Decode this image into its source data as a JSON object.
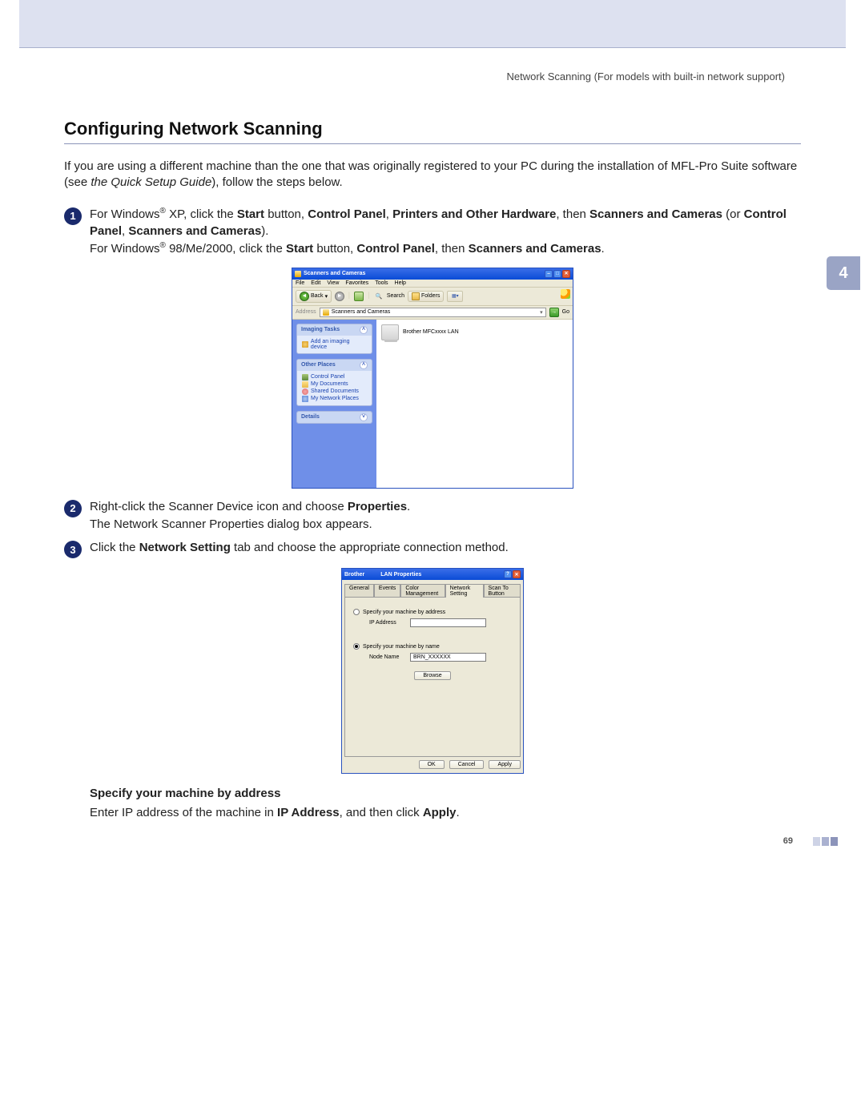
{
  "header": {
    "chapter_text": "Network Scanning (For models with built-in network support)"
  },
  "section_title": "Configuring Network Scanning",
  "intro": {
    "part1": "If you are using a different machine than the one that was originally registered to your PC during the installation of MFL-Pro Suite software (see ",
    "italic": "the Quick Setup Guide",
    "part2": "), follow the steps below."
  },
  "steps": {
    "s1": {
      "num": "1",
      "t1": "For Windows",
      "sup": "®",
      "t2": " XP, click the ",
      "b1": "Start",
      "t3": " button, ",
      "b2": "Control Panel",
      "t4": ", ",
      "b3": "Printers and Other Hardware",
      "t5": ", then ",
      "b4": "Scanners and Cameras",
      "t6": " (or ",
      "b5": "Control Panel",
      "t7": ", ",
      "b6": "Scanners and Cameras",
      "t8": ").",
      "t9": "For Windows",
      "t10": " 98/Me/2000, click the ",
      "b7": "Start",
      "t11": " button, ",
      "b8": "Control Panel",
      "t12": ", then ",
      "b9": "Scanners and Cameras",
      "t13": "."
    },
    "s2": {
      "num": "2",
      "t1": "Right-click the Scanner Device icon and choose ",
      "b1": "Properties",
      "t2": ".",
      "t3": "The Network Scanner Properties dialog box appears."
    },
    "s3": {
      "num": "3",
      "t1": "Click the ",
      "b1": "Network Setting",
      "t2": " tab and choose the appropriate connection method."
    }
  },
  "xp": {
    "title": "Scanners and Cameras",
    "menu": {
      "file": "File",
      "edit": "Edit",
      "view": "View",
      "fav": "Favorites",
      "tools": "Tools",
      "help": "Help"
    },
    "toolbar": {
      "back": "Back",
      "search": "Search",
      "folders": "Folders"
    },
    "address_label": "Address",
    "address_value": "Scanners and Cameras",
    "go": "Go",
    "panel1": {
      "title": "Imaging Tasks",
      "item1": "Add an imaging device"
    },
    "panel2": {
      "title": "Other Places",
      "i1": "Control Panel",
      "i2": "My Documents",
      "i3": "Shared Documents",
      "i4": "My Network Places"
    },
    "panel3": {
      "title": "Details"
    },
    "device": "Brother MFCxxxx LAN"
  },
  "lan": {
    "brand": "Brother",
    "title": "LAN Properties",
    "tabs": {
      "general": "General",
      "events": "Events",
      "color": "Color Management",
      "network": "Network Setting",
      "scan": "Scan To Button"
    },
    "opt1": "Specify your machine by address",
    "ip_label": "IP Address",
    "opt2": "Specify your machine by name",
    "node_label": "Node Name",
    "node_value": "BRN_XXXXXX",
    "browse": "Browse",
    "ok": "OK",
    "cancel": "Cancel",
    "apply": "Apply"
  },
  "sub": {
    "title": "Specify your machine by address",
    "t1": "Enter IP address of the machine in ",
    "b1": "IP Address",
    "t2": ", and then click ",
    "b2": "Apply",
    "t3": "."
  },
  "side_tab": "4",
  "page_number": "69"
}
